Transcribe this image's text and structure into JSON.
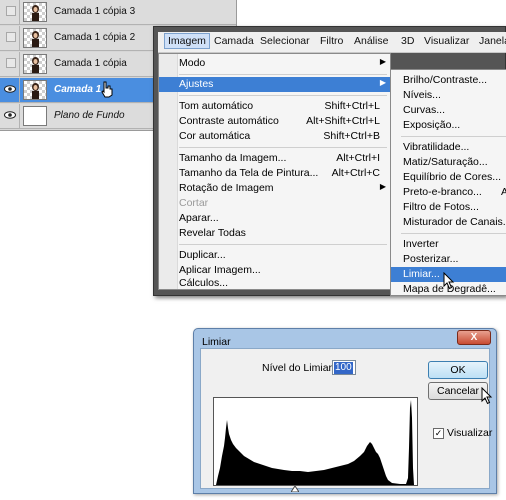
{
  "layers_panel": {
    "layers": [
      {
        "name": "Camada 1 cópia 3",
        "visible": false,
        "selected": false,
        "thumb": "photo"
      },
      {
        "name": "Camada 1 cópia 2",
        "visible": false,
        "selected": false,
        "thumb": "photo"
      },
      {
        "name": "Camada 1 cópia",
        "visible": false,
        "selected": false,
        "thumb": "photo"
      },
      {
        "name": "Camada 1",
        "visible": true,
        "selected": true,
        "thumb": "photo"
      },
      {
        "name": "Plano de Fundo",
        "visible": true,
        "selected": false,
        "thumb": "white"
      }
    ]
  },
  "menubar": {
    "items": [
      "Imagem",
      "Camada",
      "Selecionar",
      "Filtro",
      "Análise",
      "3D",
      "Visualizar",
      "Janela"
    ]
  },
  "imagem_menu": {
    "modo": "Modo",
    "ajustes": "Ajustes",
    "tom_auto": "Tom automático",
    "tom_auto_sc": "Shift+Ctrl+L",
    "contraste_auto": "Contraste automático",
    "contraste_auto_sc": "Alt+Shift+Ctrl+L",
    "cor_auto": "Cor automática",
    "cor_auto_sc": "Shift+Ctrl+B",
    "tamanho_imagem": "Tamanho da Imagem...",
    "tamanho_imagem_sc": "Alt+Ctrl+I",
    "tamanho_tela": "Tamanho da Tela de Pintura...",
    "tamanho_tela_sc": "Alt+Ctrl+C",
    "rotacao": "Rotação de Imagem",
    "cortar": "Cortar",
    "aparar": "Aparar...",
    "revelar": "Revelar Todas",
    "duplicar": "Duplicar...",
    "aplicar": "Aplicar Imagem...",
    "calculos": "Cálculos..."
  },
  "ajustes_submenu": {
    "items": [
      {
        "label": "Brilho/Contraste...",
        "sc": ""
      },
      {
        "label": "Níveis...",
        "sc": ""
      },
      {
        "label": "Curvas...",
        "sc": ""
      },
      {
        "label": "Exposição...",
        "sc": ""
      },
      {
        "label": "Vibratilidade...",
        "sc": ""
      },
      {
        "label": "Matiz/Saturação...",
        "sc": ""
      },
      {
        "label": "Equilíbrio de Cores...",
        "sc": ""
      },
      {
        "label": "Preto-e-branco...",
        "sc": "A"
      },
      {
        "label": "Filtro de Fotos...",
        "sc": ""
      },
      {
        "label": "Misturador de Canais...",
        "sc": ""
      },
      {
        "label": "Inverter",
        "sc": ""
      },
      {
        "label": "Posterizar...",
        "sc": ""
      },
      {
        "label": "Limiar...",
        "sc": ""
      },
      {
        "label": "Mapa de Degradê...",
        "sc": ""
      }
    ]
  },
  "dialog": {
    "title": "Limiar",
    "close": "X",
    "level_label": "Nível do Limiar:",
    "level_value": "100",
    "ok": "OK",
    "cancel": "Cancelar",
    "preview_label": "Visualizar",
    "preview_checked": true,
    "check_glyph": "✓"
  },
  "colors": {
    "selection": "#4a8ee0",
    "menu_highlight": "#3d7fd4",
    "dialog_frame": "#a9c6e6"
  }
}
